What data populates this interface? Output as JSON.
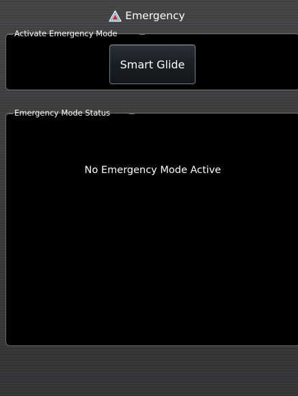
{
  "header": {
    "title": "Emergency",
    "icon": "warning-triangle-icon",
    "icon_color": "#2e9bd6"
  },
  "activate_panel": {
    "label": "Activate Emergency Mode",
    "button_label": "Smart Glide"
  },
  "status_panel": {
    "label": "Emergency Mode Status",
    "message": "No Emergency Mode Active"
  },
  "colors": {
    "background": "#3c3c3e",
    "panel": "#000000",
    "panel_border": "#6c6c70",
    "text": "#ffffff"
  }
}
